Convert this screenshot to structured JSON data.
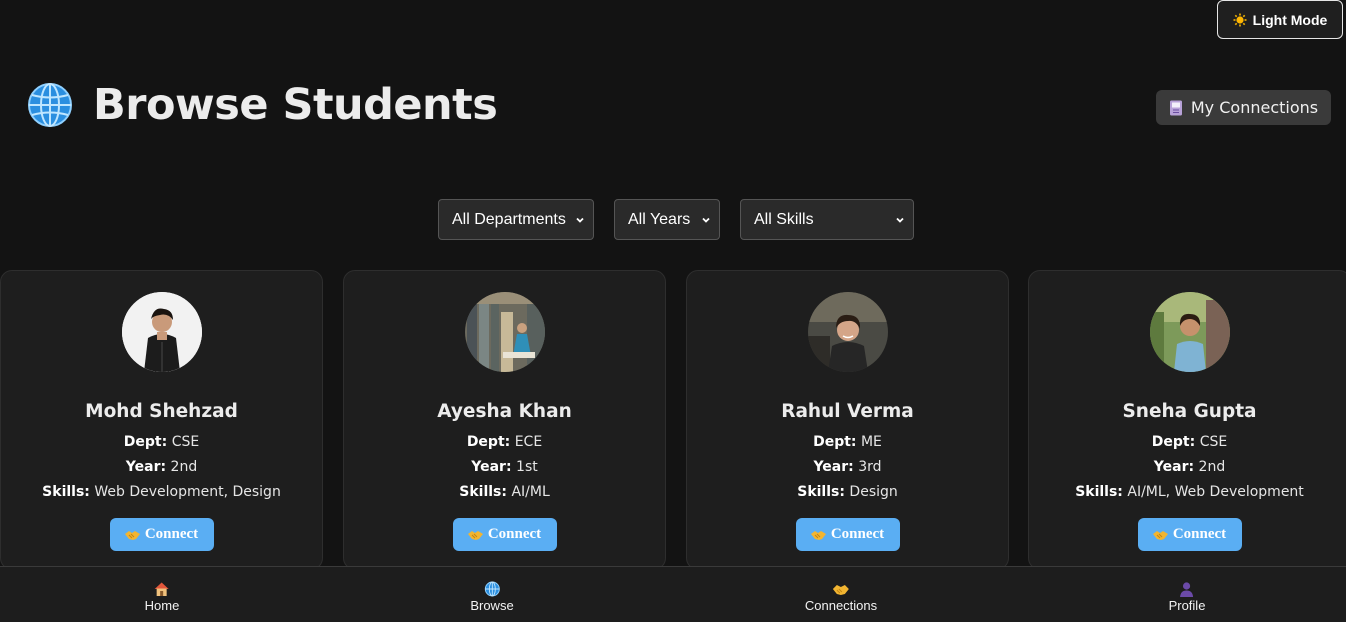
{
  "theme_toggle": {
    "label": "Light Mode",
    "icon": "sun-icon"
  },
  "header": {
    "title": "Browse Students",
    "icon": "globe-icon",
    "my_connections_label": "My Connections"
  },
  "filters": {
    "department": "All Departments",
    "year": "All Years",
    "skills": "All Skills"
  },
  "labels": {
    "dept": "Dept:",
    "year": "Year:",
    "skills": "Skills:",
    "connect": "Connect"
  },
  "students": [
    {
      "name": "Mohd Shehzad",
      "dept": "CSE",
      "year": "2nd",
      "skills": "Web Development, Design"
    },
    {
      "name": "Ayesha Khan",
      "dept": "ECE",
      "year": "1st",
      "skills": "AI/ML"
    },
    {
      "name": "Rahul Verma",
      "dept": "ME",
      "year": "3rd",
      "skills": "Design"
    },
    {
      "name": "Sneha Gupta",
      "dept": "CSE",
      "year": "2nd",
      "skills": "AI/ML, Web Development"
    }
  ],
  "nav": [
    {
      "label": "Home",
      "icon": "house-icon"
    },
    {
      "label": "Browse",
      "icon": "globe-icon"
    },
    {
      "label": "Connections",
      "icon": "handshake-icon"
    },
    {
      "label": "Profile",
      "icon": "user-icon"
    }
  ],
  "colors": {
    "background": "#131313",
    "card": "#1e1e1e",
    "accent": "#5aaef3"
  }
}
